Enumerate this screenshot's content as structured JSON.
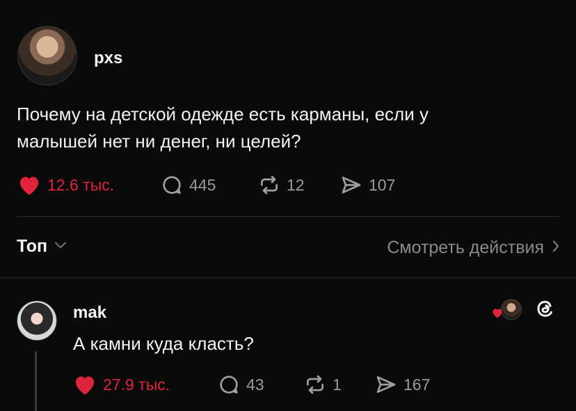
{
  "post": {
    "username": "pxs",
    "text_line1": "Почему на детской одежде есть карманы, если у",
    "text_line2": "малышей нет ни денег, ни целей?",
    "likes": "12.6 тыс.",
    "comments": "445",
    "reposts": "12",
    "shares": "107"
  },
  "sort": {
    "label": "Топ",
    "view_activity": "Смотреть действия"
  },
  "reply": {
    "username": "mak",
    "text": "А камни куда класть?",
    "likes": "27.9 тыс.",
    "comments": "43",
    "reposts": "1",
    "shares": "167"
  },
  "colors": {
    "background": "#0a0a0a",
    "like_red": "#e0243c",
    "muted": "#9a9a9a"
  },
  "icons": {
    "heart": "heart-icon",
    "comment": "comment-icon",
    "repost": "repost-icon",
    "share": "share-icon",
    "chevron": "chevron-icon",
    "threads": "threads-logo-icon"
  }
}
